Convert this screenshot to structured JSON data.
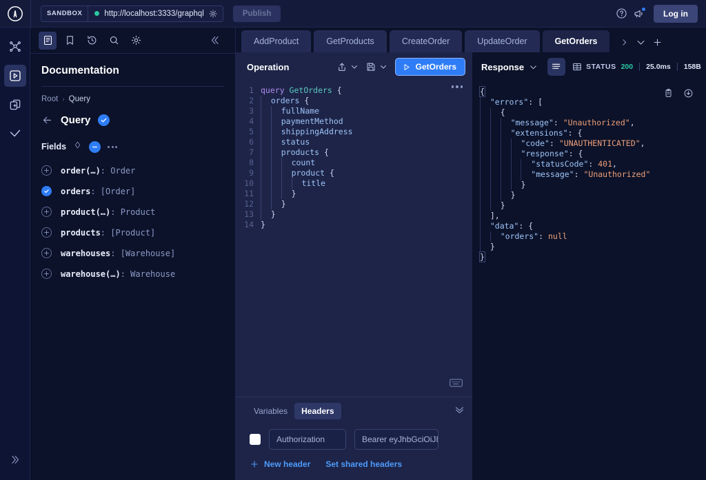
{
  "topbar": {
    "logo_icon": "apollo-logo-icon",
    "sandbox_tag": "SANDBOX",
    "endpoint_url": "http://localhost:3333/graphql",
    "endpoint_settings_icon": "gear-icon",
    "publish_label": "Publish",
    "help_icon": "help-circle-icon",
    "announcements_icon": "megaphone-icon",
    "login_label": "Log in"
  },
  "rail": {
    "items": [
      {
        "name": "schema-graph-icon",
        "label": "Schema"
      },
      {
        "name": "explorer-icon",
        "label": "Explorer"
      },
      {
        "name": "collections-icon",
        "label": "Collections"
      },
      {
        "name": "checkmark-icon",
        "label": "Checks"
      }
    ],
    "expand_icon": "chevron-double-right-icon"
  },
  "docs": {
    "toolbar": [
      {
        "name": "documentation-icon",
        "label": "Documentation"
      },
      {
        "name": "bookmark-icon",
        "label": "Saved"
      },
      {
        "name": "history-icon",
        "label": "History"
      },
      {
        "name": "search-icon",
        "label": "Search"
      },
      {
        "name": "settings-gear-icon",
        "label": "Settings"
      }
    ],
    "collapse_icon": "chevron-double-left-icon",
    "title": "Documentation",
    "breadcrumb": {
      "root": "Root",
      "separator": "›",
      "current": "Query"
    },
    "back_icon": "arrow-left-icon",
    "type_name": "Query",
    "type_check_icon": "check-icon",
    "fields_label": "Fields",
    "sort_icon": "sort-diamond-icon",
    "minus_icon": "minus-icon",
    "more_icon": "more-dots-icon",
    "fields": [
      {
        "name": "order(…)",
        "type": ": Order",
        "selected": false
      },
      {
        "name": "orders",
        "type": ": [Order]",
        "selected": true
      },
      {
        "name": "product(…)",
        "type": ": Product",
        "selected": false
      },
      {
        "name": "products",
        "type": ": [Product]",
        "selected": false
      },
      {
        "name": "warehouses",
        "type": ": [Warehouse]",
        "selected": false
      },
      {
        "name": "warehouse(…)",
        "type": ": Warehouse",
        "selected": false
      }
    ]
  },
  "tabs": {
    "items": [
      {
        "label": "AddProduct",
        "active": false
      },
      {
        "label": "GetProducts",
        "active": false
      },
      {
        "label": "CreateOrder",
        "active": false
      },
      {
        "label": "UpdateOrder",
        "active": false
      },
      {
        "label": "GetOrders",
        "active": true
      }
    ],
    "scroll_right_icon": "chevron-right-icon",
    "tab_menu_icon": "chevron-down-icon",
    "new_tab_icon": "plus-icon"
  },
  "operation": {
    "title": "Operation",
    "share_icon": "share-upload-icon",
    "share_chevron_icon": "chevron-down-icon",
    "save_icon": "save-disk-icon",
    "save_chevron_icon": "chevron-down-icon",
    "run_icon": "play-icon",
    "run_label": "GetOrders",
    "more_icon": "more-dots-icon",
    "keyboard_icon": "keyboard-icon",
    "code_lines": [
      {
        "n": "1",
        "segments": [
          {
            "t": "query ",
            "c": "kw"
          },
          {
            "t": "GetOrders",
            "c": "op"
          },
          {
            "t": " {",
            "c": "br"
          }
        ]
      },
      {
        "n": "2",
        "indent": 1,
        "segments": [
          {
            "t": "orders",
            "c": "fld"
          },
          {
            "t": " {",
            "c": "br"
          }
        ]
      },
      {
        "n": "3",
        "indent": 2,
        "segments": [
          {
            "t": "fullName",
            "c": "fld"
          }
        ]
      },
      {
        "n": "4",
        "indent": 2,
        "segments": [
          {
            "t": "paymentMethod",
            "c": "fld"
          }
        ]
      },
      {
        "n": "5",
        "indent": 2,
        "segments": [
          {
            "t": "shippingAddress",
            "c": "fld"
          }
        ]
      },
      {
        "n": "6",
        "indent": 2,
        "segments": [
          {
            "t": "status",
            "c": "fld"
          }
        ]
      },
      {
        "n": "7",
        "indent": 2,
        "segments": [
          {
            "t": "products",
            "c": "fld"
          },
          {
            "t": " {",
            "c": "br"
          }
        ]
      },
      {
        "n": "8",
        "indent": 3,
        "segments": [
          {
            "t": "count",
            "c": "fld"
          }
        ]
      },
      {
        "n": "9",
        "indent": 3,
        "segments": [
          {
            "t": "product",
            "c": "fld"
          },
          {
            "t": " {",
            "c": "br"
          }
        ]
      },
      {
        "n": "10",
        "indent": 4,
        "segments": [
          {
            "t": "title",
            "c": "fld"
          }
        ]
      },
      {
        "n": "11",
        "indent": 3,
        "segments": [
          {
            "t": "}",
            "c": "br"
          }
        ]
      },
      {
        "n": "12",
        "indent": 2,
        "segments": [
          {
            "t": "}",
            "c": "br"
          }
        ]
      },
      {
        "n": "13",
        "indent": 1,
        "segments": [
          {
            "t": "}",
            "c": "br"
          }
        ]
      },
      {
        "n": "14",
        "indent": 0,
        "segments": [
          {
            "t": "}",
            "c": "br"
          }
        ]
      }
    ]
  },
  "variables": {
    "tab_variables": "Variables",
    "tab_headers": "Headers",
    "collapse_icon": "chevron-double-down-icon",
    "header_row": {
      "enabled": false,
      "key_value": "Authorization",
      "value_value": "Bearer eyJhbGciOiJII"
    },
    "new_header_icon": "plus-icon",
    "new_header_label": "New header",
    "shared_headers_label": "Set shared headers"
  },
  "response": {
    "title": "Response",
    "title_chevron_icon": "chevron-down-icon",
    "json_view_icon": "json-list-icon",
    "table_view_icon": "table-grid-icon",
    "copy_icon": "clipboard-icon",
    "download_icon": "download-icon",
    "status_label": "STATUS",
    "status_code": "200",
    "duration": "25.0ms",
    "size": "158B",
    "json_lines": [
      {
        "indent": 0,
        "segments": [
          {
            "t": "{",
            "c": "pun"
          }
        ],
        "bracket": true
      },
      {
        "indent": 1,
        "segments": [
          {
            "t": "\"errors\"",
            "c": "key"
          },
          {
            "t": ": [",
            "c": "pun"
          }
        ]
      },
      {
        "indent": 2,
        "segments": [
          {
            "t": "{",
            "c": "pun"
          }
        ]
      },
      {
        "indent": 3,
        "segments": [
          {
            "t": "\"message\"",
            "c": "key"
          },
          {
            "t": ": ",
            "c": "pun"
          },
          {
            "t": "\"Unauthorized\"",
            "c": "str"
          },
          {
            "t": ",",
            "c": "pun"
          }
        ]
      },
      {
        "indent": 3,
        "segments": [
          {
            "t": "\"extensions\"",
            "c": "key"
          },
          {
            "t": ": {",
            "c": "pun"
          }
        ]
      },
      {
        "indent": 4,
        "segments": [
          {
            "t": "\"code\"",
            "c": "key"
          },
          {
            "t": ": ",
            "c": "pun"
          },
          {
            "t": "\"UNAUTHENTICATED\"",
            "c": "str"
          },
          {
            "t": ",",
            "c": "pun"
          }
        ]
      },
      {
        "indent": 4,
        "segments": [
          {
            "t": "\"response\"",
            "c": "key"
          },
          {
            "t": ": {",
            "c": "pun"
          }
        ]
      },
      {
        "indent": 5,
        "segments": [
          {
            "t": "\"statusCode\"",
            "c": "key"
          },
          {
            "t": ": ",
            "c": "pun"
          },
          {
            "t": "401",
            "c": "num"
          },
          {
            "t": ",",
            "c": "pun"
          }
        ]
      },
      {
        "indent": 5,
        "segments": [
          {
            "t": "\"message\"",
            "c": "key"
          },
          {
            "t": ": ",
            "c": "pun"
          },
          {
            "t": "\"Unauthorized\"",
            "c": "str"
          }
        ]
      },
      {
        "indent": 4,
        "segments": [
          {
            "t": "}",
            "c": "pun"
          }
        ]
      },
      {
        "indent": 3,
        "segments": [
          {
            "t": "}",
            "c": "pun"
          }
        ]
      },
      {
        "indent": 2,
        "segments": [
          {
            "t": "}",
            "c": "pun"
          }
        ]
      },
      {
        "indent": 1,
        "segments": [
          {
            "t": "],",
            "c": "pun"
          }
        ]
      },
      {
        "indent": 1,
        "segments": [
          {
            "t": "\"data\"",
            "c": "key"
          },
          {
            "t": ": {",
            "c": "pun"
          }
        ]
      },
      {
        "indent": 2,
        "segments": [
          {
            "t": "\"orders\"",
            "c": "key"
          },
          {
            "t": ": ",
            "c": "pun"
          },
          {
            "t": "null",
            "c": "null"
          }
        ]
      },
      {
        "indent": 1,
        "segments": [
          {
            "t": "}",
            "c": "pun"
          }
        ]
      },
      {
        "indent": 0,
        "segments": [
          {
            "t": "}",
            "c": "pun"
          }
        ],
        "bracket": true
      }
    ]
  }
}
